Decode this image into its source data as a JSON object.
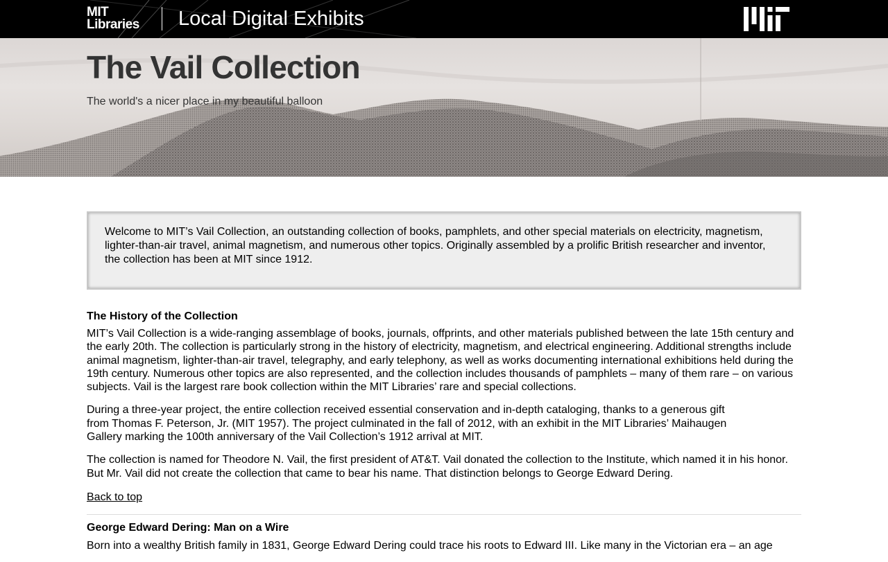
{
  "header": {
    "logo_line1": "MIT",
    "logo_line2": "Libraries",
    "site_title": "Local Digital Exhibits"
  },
  "hero": {
    "title": "The Vail Collection",
    "subtitle": "The world's a nicer place in my beautiful balloon"
  },
  "intro": "Welcome to MIT’s Vail Collection, an outstanding collection of books, pamphlets, and other special materials on electricity, magnetism, lighter-than-air travel, animal magnetism, and numerous other topics. Originally assembled by a prolific British researcher and inventor, the collection has been at MIT since 1912.",
  "history": {
    "heading": "The History of the Collection",
    "paragraphs": [
      "MIT’s Vail Collection is a wide-ranging assemblage of books, journals, offprints, and other materials published between the late 15th century and the early 20th. The collection is particularly strong in the history of electricity, magnetism, and electrical engineering. Additional strengths include animal magnetism, lighter-than-air travel, telegraphy, and early telephony, as well as works documenting international exhibitions held during the 19th century. Numerous other topics are also represented, and the collection includes thousands of pamphlets – many of them rare – on various subjects. Vail is the largest rare book collection within the MIT Libraries’ rare and special collections.",
      "During a three-year project, the entire collection received essential conservation and in-depth cataloging, thanks to a generous gift from Thomas F. Peterson, Jr. (MIT 1957). The project culminated in the fall of 2012, with an exhibit in the MIT Libraries’ Maihaugen Gallery marking the 100th anniversary of the Vail Collection’s 1912 arrival at MIT.",
      "The collection is named for Theodore N. Vail, the first president of AT&T. Vail donated the collection to the Institute, which named it in his honor. But Mr. Vail did not create the collection that came to bear his name. That distinction belongs to George Edward Dering."
    ],
    "back_to_top": "Back to top"
  },
  "dering": {
    "heading": "George Edward Dering: Man on a Wire",
    "paragraph": "Born into a wealthy British family in 1831, George Edward Dering could trace his roots to Edward III. Like many in the Victorian era – an age"
  }
}
